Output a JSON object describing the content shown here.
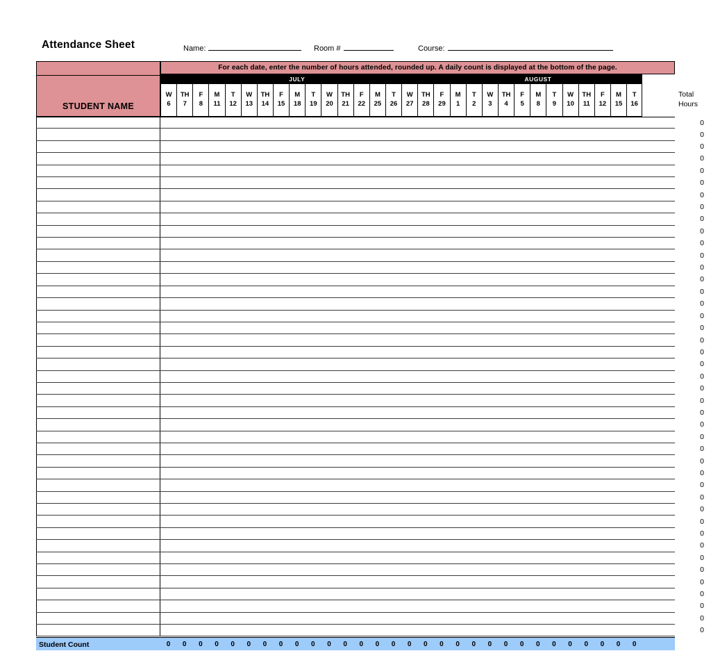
{
  "header": {
    "title": "Attendance Sheet",
    "fields": [
      {
        "id": "name",
        "label": "Name:"
      },
      {
        "id": "room",
        "label": "Room #"
      },
      {
        "id": "course",
        "label": "Course:"
      }
    ]
  },
  "table": {
    "instruction": "For each date, enter the number of hours attended, rounded up. A daily count is displayed at the bottom of the page.",
    "name_column_header": "STUDENT NAME",
    "total_column_header_line1": "Total",
    "total_column_header_line2": "Hours",
    "months": [
      {
        "name": "JULY",
        "span": 17
      },
      {
        "name": "AUGUST",
        "span": 13
      }
    ],
    "dates": [
      {
        "dow": "W",
        "day": "6"
      },
      {
        "dow": "TH",
        "day": "7"
      },
      {
        "dow": "F",
        "day": "8"
      },
      {
        "dow": "M",
        "day": "11"
      },
      {
        "dow": "T",
        "day": "12"
      },
      {
        "dow": "W",
        "day": "13"
      },
      {
        "dow": "TH",
        "day": "14"
      },
      {
        "dow": "F",
        "day": "15"
      },
      {
        "dow": "M",
        "day": "18"
      },
      {
        "dow": "T",
        "day": "19"
      },
      {
        "dow": "W",
        "day": "20"
      },
      {
        "dow": "TH",
        "day": "21"
      },
      {
        "dow": "F",
        "day": "22"
      },
      {
        "dow": "M",
        "day": "25"
      },
      {
        "dow": "T",
        "day": "26"
      },
      {
        "dow": "W",
        "day": "27"
      },
      {
        "dow": "TH",
        "day": "28"
      },
      {
        "dow": "F",
        "day": "29"
      },
      {
        "dow": "M",
        "day": "1"
      },
      {
        "dow": "T",
        "day": "2"
      },
      {
        "dow": "W",
        "day": "3"
      },
      {
        "dow": "TH",
        "day": "4"
      },
      {
        "dow": "F",
        "day": "5"
      },
      {
        "dow": "M",
        "day": "8"
      },
      {
        "dow": "T",
        "day": "9"
      },
      {
        "dow": "W",
        "day": "10"
      },
      {
        "dow": "TH",
        "day": "11"
      },
      {
        "dow": "F",
        "day": "12"
      },
      {
        "dow": "M",
        "day": "15"
      },
      {
        "dow": "T",
        "day": "16"
      }
    ],
    "rows": [
      {
        "name": "",
        "total": "0"
      },
      {
        "name": "",
        "total": "0"
      },
      {
        "name": "",
        "total": "0"
      },
      {
        "name": "",
        "total": "0"
      },
      {
        "name": "",
        "total": "0"
      },
      {
        "name": "",
        "total": "0"
      },
      {
        "name": "",
        "total": "0"
      },
      {
        "name": "",
        "total": "0"
      },
      {
        "name": "",
        "total": "0"
      },
      {
        "name": "",
        "total": "0"
      },
      {
        "name": "",
        "total": "0"
      },
      {
        "name": "",
        "total": "0"
      },
      {
        "name": "",
        "total": "0"
      },
      {
        "name": "",
        "total": "0"
      },
      {
        "name": "",
        "total": "0"
      },
      {
        "name": "",
        "total": "0"
      },
      {
        "name": "",
        "total": "0"
      },
      {
        "name": "",
        "total": "0"
      },
      {
        "name": "",
        "total": "0"
      },
      {
        "name": "",
        "total": "0"
      },
      {
        "name": "",
        "total": "0"
      },
      {
        "name": "",
        "total": "0"
      },
      {
        "name": "",
        "total": "0"
      },
      {
        "name": "",
        "total": "0"
      },
      {
        "name": "",
        "total": "0"
      },
      {
        "name": "",
        "total": "0"
      },
      {
        "name": "",
        "total": "0"
      },
      {
        "name": "",
        "total": "0"
      },
      {
        "name": "",
        "total": "0"
      },
      {
        "name": "",
        "total": "0"
      },
      {
        "name": "",
        "total": "0"
      },
      {
        "name": "",
        "total": "0"
      },
      {
        "name": "",
        "total": "0"
      },
      {
        "name": "",
        "total": "0"
      },
      {
        "name": "",
        "total": "0"
      },
      {
        "name": "",
        "total": "0"
      },
      {
        "name": "",
        "total": "0"
      },
      {
        "name": "",
        "total": "0"
      },
      {
        "name": "",
        "total": "0"
      },
      {
        "name": "",
        "total": "0"
      },
      {
        "name": "",
        "total": "0"
      },
      {
        "name": "",
        "total": "0"
      },
      {
        "name": "",
        "total": "0"
      }
    ],
    "footer": {
      "label": "Student Count",
      "counts": [
        "0",
        "0",
        "0",
        "0",
        "0",
        "0",
        "0",
        "0",
        "0",
        "0",
        "0",
        "0",
        "0",
        "0",
        "0",
        "0",
        "0",
        "0",
        "0",
        "0",
        "0",
        "0",
        "0",
        "0",
        "0",
        "0",
        "0",
        "0",
        "0",
        "0"
      ]
    }
  },
  "colors": {
    "header_pink": "#de9295",
    "footer_blue": "#9dcbfa",
    "month_band": "#000000",
    "rule": "#000000"
  }
}
